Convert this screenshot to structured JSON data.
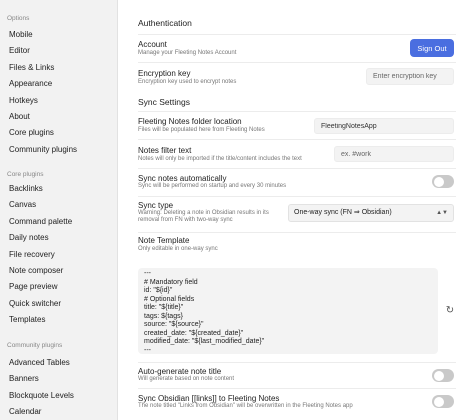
{
  "sidebar": {
    "sections": [
      {
        "header": "Options",
        "items": [
          "Mobile",
          "Editor",
          "Files & Links",
          "Appearance",
          "Hotkeys",
          "About",
          "Core plugins",
          "Community plugins"
        ]
      },
      {
        "header": "Core plugins",
        "items": [
          "Backlinks",
          "Canvas",
          "Command palette",
          "Daily notes",
          "File recovery",
          "Note composer",
          "Page preview",
          "Quick switcher",
          "Templates"
        ]
      },
      {
        "header": "Community plugins",
        "items": [
          "Advanced Tables",
          "Banners",
          "Blockquote Levels",
          "Calendar"
        ]
      }
    ]
  },
  "main": {
    "authentication_title": "Authentication",
    "account": {
      "name": "Account",
      "desc": "Manage your Fleeting Notes Account",
      "button": "Sign Out"
    },
    "encryption": {
      "name": "Encryption key",
      "desc": "Encryption key used to encrypt notes",
      "placeholder": "Enter encryption key"
    },
    "sync_title": "Sync Settings",
    "folder": {
      "name": "Fleeting Notes folder location",
      "desc": "Files will be populated here from Fleeting Notes",
      "value": "FleetingNotesApp"
    },
    "filter": {
      "name": "Notes filter text",
      "desc": "Notes will only be imported if the title/content includes the text",
      "placeholder": "ex. #work"
    },
    "sync_auto": {
      "name": "Sync notes automatically",
      "desc": "Sync will be performed on startup and every 30 minutes"
    },
    "sync_type": {
      "name": "Sync type",
      "desc_line1": "Warning: Deleting a note in Obsidian results in its",
      "desc_line2": "removal from FN with two-way sync",
      "selected": "One-way sync (FN ⇒ Obsidian)"
    },
    "template": {
      "name": "Note Template",
      "desc": "Only editable in one-way sync",
      "lines": [
        "---",
        "# Mandatory field",
        "id: \"${id}\"",
        "# Optional fields",
        "title: \"${title}\"",
        "tags: ${tags}",
        "source: \"${source}\"",
        "created_date: \"${created_date}\"",
        "modified_date: \"${last_modified_date}\"",
        "---"
      ]
    },
    "auto_title": {
      "name": "Auto-generate note title",
      "desc": "Will generate based on note content"
    },
    "sync_links": {
      "name": "Sync Obsidian [[links]] to Fleeting Notes",
      "desc": "The note titled \"Links from Obsidian\" will be overwritten in the Fleeting Notes app"
    }
  },
  "icons": {
    "refresh": "refresh-icon",
    "chevron": "chevron-updown-icon"
  }
}
